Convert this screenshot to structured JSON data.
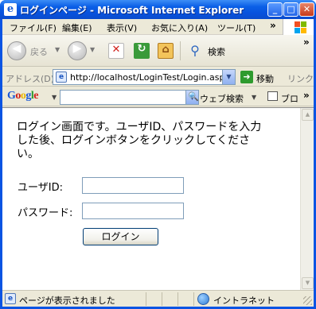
{
  "window": {
    "title": "ログインページ - Microsoft Internet Explorer",
    "icon": "ie-page-icon"
  },
  "menu": {
    "items": [
      "ファイル(F)",
      "編集(E)",
      "表示(V)",
      "お気に入り(A)",
      "ツール(T)"
    ],
    "overflow": "»"
  },
  "toolbar": {
    "back_label": "戻る",
    "search_label": "検索",
    "overflow": "»"
  },
  "address": {
    "label": "アドレス(D)",
    "url": "http://localhost/LoginTest/Login.aspx",
    "go_label": "移動",
    "links_label": "リンク"
  },
  "googlebar": {
    "logo": "Google",
    "search_value": "",
    "web_search_label": "ウェブ検索",
    "blog_label": "ブロ",
    "overflow": "»"
  },
  "page": {
    "intro": "ログイン画面です。ユーザID、パスワードを入力した後、ログインボタンをクリックしてください。",
    "userid_label": "ユーザID:",
    "userid_value": "",
    "password_label": "パスワード:",
    "password_value": "",
    "login_button": "ログイン"
  },
  "status": {
    "text": "ページが表示されました",
    "zone": "イントラネット"
  },
  "colors": {
    "titlebar": "#0a54e3",
    "chrome": "#ece9d8",
    "go_green": "#2e9b2e"
  }
}
